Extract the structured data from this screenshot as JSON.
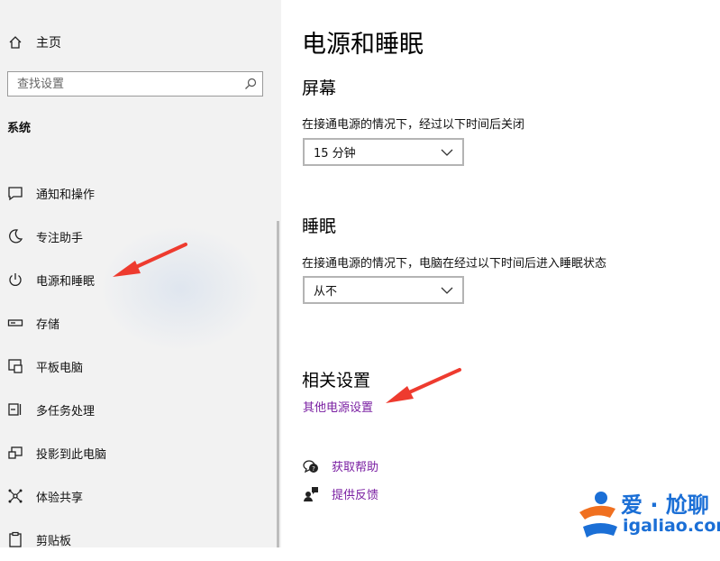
{
  "sidebar": {
    "home_label": "主页",
    "search_placeholder": "查找设置",
    "section_title": "系统",
    "items": [
      {
        "label": "通知和操作",
        "icon": "notification-icon"
      },
      {
        "label": "专注助手",
        "icon": "moon-icon"
      },
      {
        "label": "电源和睡眠",
        "icon": "power-icon"
      },
      {
        "label": "存储",
        "icon": "storage-icon"
      },
      {
        "label": "平板电脑",
        "icon": "tablet-icon"
      },
      {
        "label": "多任务处理",
        "icon": "multitask-icon"
      },
      {
        "label": "投影到此电脑",
        "icon": "project-icon"
      },
      {
        "label": "体验共享",
        "icon": "share-icon"
      },
      {
        "label": "剪贴板",
        "icon": "clipboard-icon"
      }
    ]
  },
  "main": {
    "title": "电源和睡眠",
    "screen": {
      "heading": "屏幕",
      "desc": "在接通电源的情况下，经过以下时间后关闭",
      "value": "15 分钟"
    },
    "sleep": {
      "heading": "睡眠",
      "desc": "在接通电源的情况下，电脑在经过以下时间后进入睡眠状态",
      "value": "从不"
    },
    "related": {
      "heading": "相关设置",
      "link": "其他电源设置"
    },
    "help": {
      "get_help": "获取帮助",
      "feedback": "提供反馈"
    }
  },
  "watermark": {
    "title": "爱 · 尬聊",
    "url": "igaliao.com"
  },
  "colors": {
    "accent_link": "#7a1fa2",
    "annotation_arrow": "#ee3b2f",
    "watermark_blue": "#1b6fd6"
  }
}
